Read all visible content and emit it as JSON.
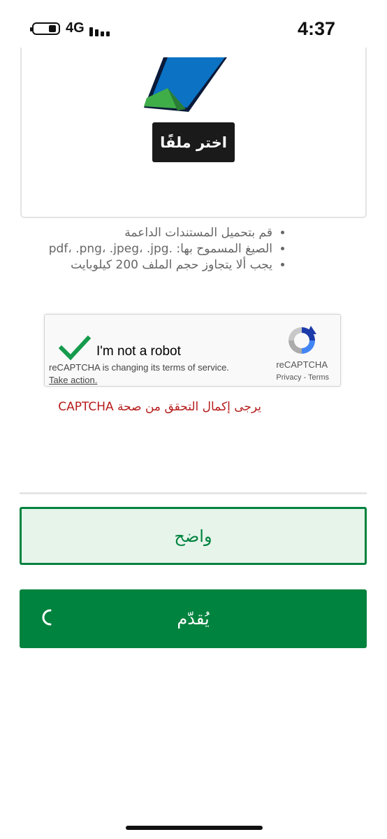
{
  "status_bar": {
    "network": "4G",
    "time": "4:37"
  },
  "upload": {
    "choose_file_label": "اختر ملفًا",
    "hints": [
      "قم بتحميل المستندات الداعمة",
      "الصيغ المسموح بها: .pdf، .png، .jpeg، .jpg",
      "يجب ألا يتجاوز حجم الملف 200 كيلوبايت"
    ]
  },
  "recaptcha": {
    "label": "I'm not a robot",
    "notice": "reCAPTCHA is changing its terms of service.",
    "action": "Take action.",
    "brand": "reCAPTCHA",
    "privacy": "Privacy",
    "terms": "Terms",
    "separator": " - "
  },
  "captcha_error": "يرجى إكمال التحقق من صحة CAPTCHA",
  "buttons": {
    "clear_label": "واضح",
    "submit_label": "يُقدّم"
  },
  "colors": {
    "primary_green": "#00833e",
    "light_green": "#e6f4ea",
    "error_red": "#b71c1c",
    "dark_button": "#1a1a1a"
  },
  "icons": {
    "battery": "battery-icon",
    "signal": "signal-bars-icon",
    "checkmark": "checkmark-icon",
    "recaptcha_logo": "recaptcha-logo-icon",
    "spinner": "loading-spinner-icon"
  }
}
